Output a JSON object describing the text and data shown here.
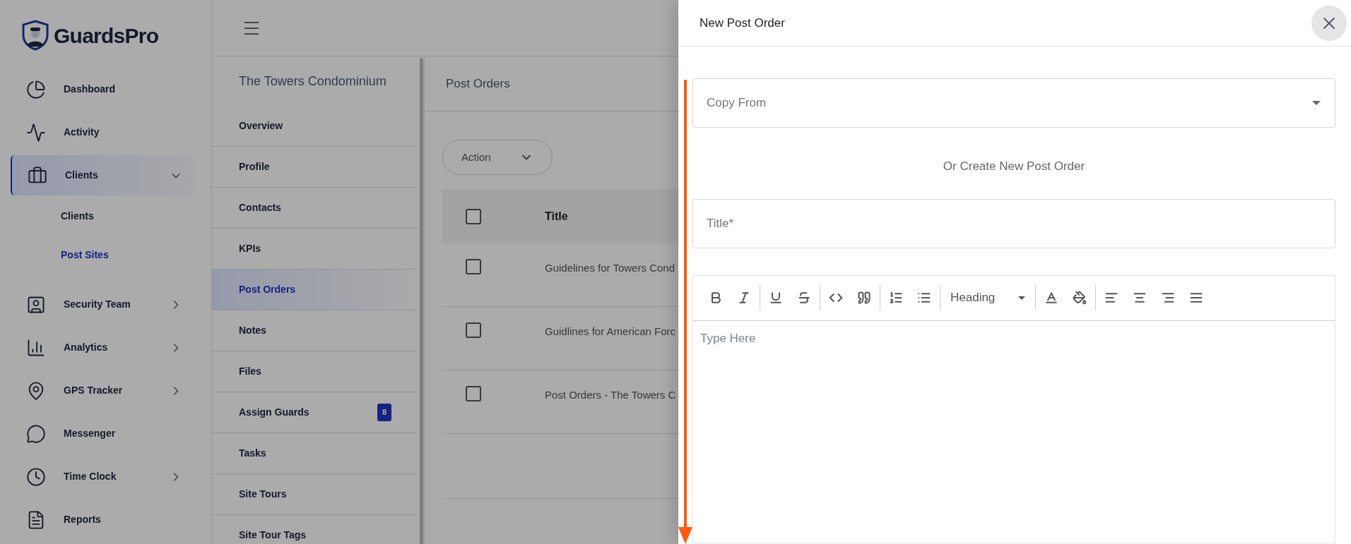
{
  "brand": {
    "name": "GuardsPro"
  },
  "sidebar": {
    "items": [
      {
        "label": "Dashboard",
        "selected": false
      },
      {
        "label": "Activity",
        "selected": false
      },
      {
        "label": "Clients",
        "expanded": true,
        "selected": true,
        "children": [
          {
            "label": "Clients",
            "selected": false
          },
          {
            "label": "Post Sites",
            "selected": true
          }
        ]
      },
      {
        "label": "Security Team",
        "expanded": false,
        "selected": false
      },
      {
        "label": "Analytics",
        "expanded": false,
        "selected": false
      },
      {
        "label": "GPS Tracker",
        "expanded": false,
        "selected": false
      },
      {
        "label": "Messenger",
        "selected": false
      },
      {
        "label": "Time Clock",
        "expanded": false,
        "selected": false
      },
      {
        "label": "Reports",
        "selected": false
      }
    ]
  },
  "site_menu": {
    "title": "The Towers Condominium",
    "items": [
      {
        "label": "Overview",
        "selected": false
      },
      {
        "label": "Profile",
        "selected": false
      },
      {
        "label": "Contacts",
        "selected": false
      },
      {
        "label": "KPIs",
        "selected": false
      },
      {
        "label": "Post Orders",
        "selected": true
      },
      {
        "label": "Notes",
        "selected": false
      },
      {
        "label": "Files",
        "selected": false
      },
      {
        "label": "Assign Guards",
        "selected": false,
        "badge": "8"
      },
      {
        "label": "Tasks",
        "selected": false
      },
      {
        "label": "Site Tours",
        "selected": false
      },
      {
        "label": "Site Tour Tags",
        "selected": false
      }
    ]
  },
  "content": {
    "title": "Post Orders",
    "action_button": "Action",
    "table": {
      "columns": [
        "Title"
      ],
      "header_checked": false,
      "rows": [
        {
          "checked": false,
          "title": "Guidelines for Towers Cond"
        },
        {
          "checked": false,
          "title": "Guidlines for American Forc"
        },
        {
          "checked": false,
          "title": "Post Orders - The Towers C"
        }
      ]
    }
  },
  "drawer": {
    "title": "New Post Order",
    "copy_from": {
      "placeholder": "Copy From"
    },
    "divider_text": "Or Create New Post Order",
    "title_field": {
      "placeholder": "Title*"
    },
    "editor": {
      "heading_select": "Heading",
      "placeholder": "Type Here"
    }
  }
}
